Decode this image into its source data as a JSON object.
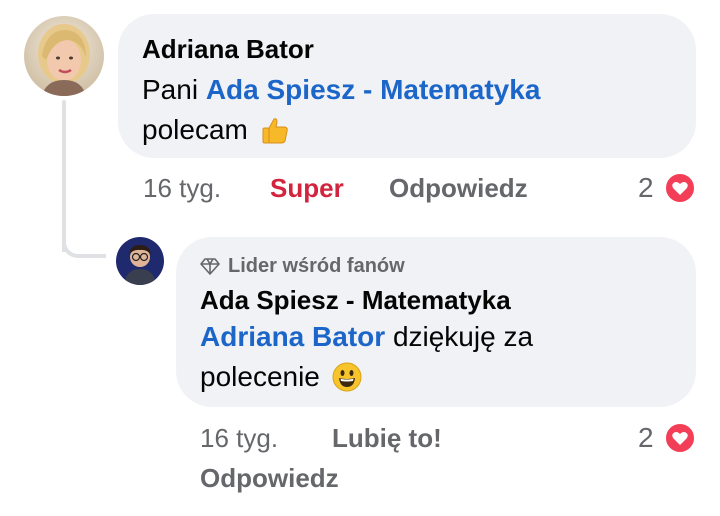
{
  "comment": {
    "author": "Adriana Bator",
    "text_prefix": "Pani",
    "mention": "Ada Spiesz - Matematyka",
    "text_suffix": "polecam",
    "emoji": "thumbs-up",
    "time": "16 tyg.",
    "reaction_label": "Super",
    "reply_label": "Odpowiedz",
    "reaction_count": "2"
  },
  "reply": {
    "badge": "Lider wśród fanów",
    "author": "Ada Spiesz - Matematyka",
    "mention": "Adriana Bator",
    "text_suffix": "dziękuję za",
    "text_line2": "polecenie",
    "emoji": "grinning-face",
    "time": "16 tyg.",
    "like_label": "Lubię to!",
    "reply_label": "Odpowiedz",
    "reaction_count": "2"
  },
  "colors": {
    "bubble": "#f0f2f5",
    "mention": "#1c65c9",
    "meta": "#65676b",
    "super_reaction": "#d2243f",
    "heart_badge": "#f33e58"
  }
}
